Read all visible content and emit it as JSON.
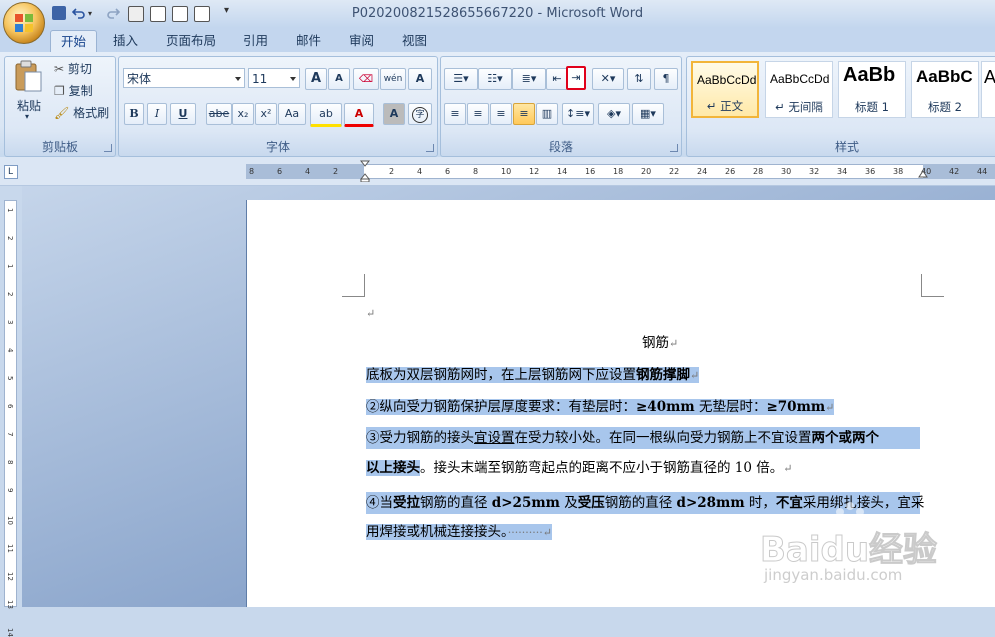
{
  "window": {
    "title": "P020200821528655667220 - Microsoft Word"
  },
  "quick_access": {
    "icons": [
      "save-icon",
      "undo-icon",
      "redo-icon",
      "print-icon",
      "print-preview-icon",
      "open-icon",
      "new-doc-icon"
    ]
  },
  "tabs": [
    "开始",
    "插入",
    "页面布局",
    "引用",
    "邮件",
    "审阅",
    "视图"
  ],
  "clipboard": {
    "paste_label": "粘贴",
    "cut_label": "剪切",
    "copy_label": "复制",
    "format_painter_label": "格式刷",
    "group_label": "剪贴板"
  },
  "font": {
    "name": "宋体",
    "size": "11",
    "grow_label": "A",
    "shrink_label": "A",
    "change_case_label": "Aa",
    "group_label": "字体",
    "bold": "B",
    "italic": "I",
    "underline": "U",
    "strike": "abe",
    "subscript": "x₂",
    "superscript": "x²",
    "highlight_label": "ab",
    "color_label": "A",
    "char_shade_label": "A",
    "phonetic_label": "wén",
    "enclosed_label": "字"
  },
  "paragraph": {
    "group_label": "段落",
    "highlighted_button": "increase-indent-button"
  },
  "styles": {
    "group_label": "样式",
    "items": [
      {
        "sample": "AaBbCcDd",
        "name": "↵ 正文",
        "selected": true
      },
      {
        "sample": "AaBbCcDd",
        "name": "↵ 无间隔",
        "selected": false
      },
      {
        "sample": "AaBb",
        "name": "标题 1",
        "selected": false
      },
      {
        "sample": "AaBbC",
        "name": "标题 2",
        "selected": false
      },
      {
        "sample": "A",
        "name": "",
        "selected": false
      }
    ]
  },
  "ruler": {
    "ticks": [
      "8",
      "6",
      "4",
      "2",
      "",
      "2",
      "4",
      "6",
      "8",
      "10",
      "12",
      "14",
      "16",
      "18",
      "20",
      "22",
      "24",
      "26",
      "28",
      "30",
      "32",
      "34",
      "36",
      "38",
      "40",
      "42",
      "44"
    ]
  },
  "vruler": {
    "ticks": [
      "1",
      "2",
      "1",
      "2",
      "3",
      "4",
      "5",
      "6",
      "7",
      "8",
      "9",
      "10",
      "11",
      "12",
      "13",
      "14"
    ]
  },
  "document": {
    "empty_mark": "↵",
    "title": "钢筋",
    "p1_a": "底板为双层钢筋网时，在上层钢筋网下应设置",
    "p1_b": "钢筋撑脚",
    "p2_a": "②纵向受力钢筋保护层厚度要求：有垫层时：",
    "p2_b": "≥40mm",
    "p2_c": " 无垫层时：",
    "p2_d": "≥70mm",
    "p3_a": "③受力钢筋的接头",
    "p3_u": "宜设置",
    "p3_b": "在受力较小处。在同一根纵向受力钢筋上不宜设置",
    "p3_c": "两个或两个",
    "p3_d": "以上接头",
    "p3_e": "。接头末端至钢筋弯起点的距离不应小于钢筋直径的 10 倍。",
    "p4_a": "④当",
    "p4_b": "受拉",
    "p4_c": "钢筋的直径 ",
    "p4_d": "d>25mm",
    "p4_e": " 及",
    "p4_f": "受压",
    "p4_g": "钢筋的直径 ",
    "p4_h": "d>28mm",
    "p4_i": " 时，",
    "p4_j": "不宜",
    "p4_k": "采用绑扎接头，宜采",
    "p4_l": "用焊接或机械连接接头。",
    "p4_dots": "··········"
  },
  "watermark": {
    "logo_text": "Baidu经验",
    "url": "jingyan.baidu.com"
  },
  "colors": {
    "ribbon_bg": "#dae6f4",
    "selection": "#a8c6ec",
    "highlight_box": "#e0001a",
    "doc_bg": "#93acd0"
  }
}
